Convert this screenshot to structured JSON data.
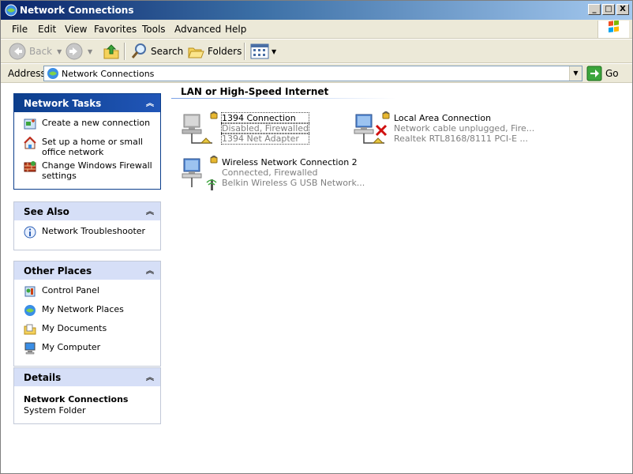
{
  "window": {
    "title": "Network Connections",
    "buttons": {
      "minimize": "_",
      "maximize": "□",
      "close": "X"
    }
  },
  "menu": [
    "File",
    "Edit",
    "View",
    "Favorites",
    "Tools",
    "Advanced",
    "Help"
  ],
  "toolbar": {
    "back_label": "Back",
    "search_label": "Search",
    "folders_label": "Folders"
  },
  "address": {
    "label": "Address",
    "value": "Network Connections",
    "go_label": "Go"
  },
  "tasks": {
    "network_tasks": {
      "title": "Network Tasks",
      "items": [
        {
          "label": "Create a new connection",
          "icon": "new-connection-icon"
        },
        {
          "label": "Set up a home or small office network",
          "icon": "home-network-icon"
        },
        {
          "label": "Change Windows Firewall settings",
          "icon": "firewall-icon"
        }
      ]
    },
    "see_also": {
      "title": "See Also",
      "items": [
        {
          "label": "Network Troubleshooter",
          "icon": "info-icon"
        }
      ]
    },
    "other_places": {
      "title": "Other Places",
      "items": [
        {
          "label": "Control Panel",
          "icon": "control-panel-icon"
        },
        {
          "label": "My Network Places",
          "icon": "network-places-icon"
        },
        {
          "label": "My Documents",
          "icon": "documents-folder-icon"
        },
        {
          "label": "My Computer",
          "icon": "computer-icon"
        }
      ]
    },
    "details": {
      "title": "Details",
      "name": "Network Connections",
      "type": "System Folder"
    }
  },
  "content": {
    "group_title": "LAN or High-Speed Internet",
    "connections": [
      {
        "name": "1394 Connection",
        "status": "Disabled, Firewalled",
        "device": "1394 Net Adapter"
      },
      {
        "name": "Local Area Connection",
        "status": "Network cable unplugged, Fire...",
        "device": "Realtek RTL8168/8111 PCI-E ..."
      },
      {
        "name": "Wireless Network Connection 2",
        "status": "Connected, Firewalled",
        "device": "Belkin Wireless G USB Network..."
      }
    ]
  },
  "colors": {
    "title_bar": "#0a246a",
    "task_header_dark": "#0c3e8c",
    "task_header_light": "#d6dff7",
    "link_blue": "#215dc6"
  }
}
